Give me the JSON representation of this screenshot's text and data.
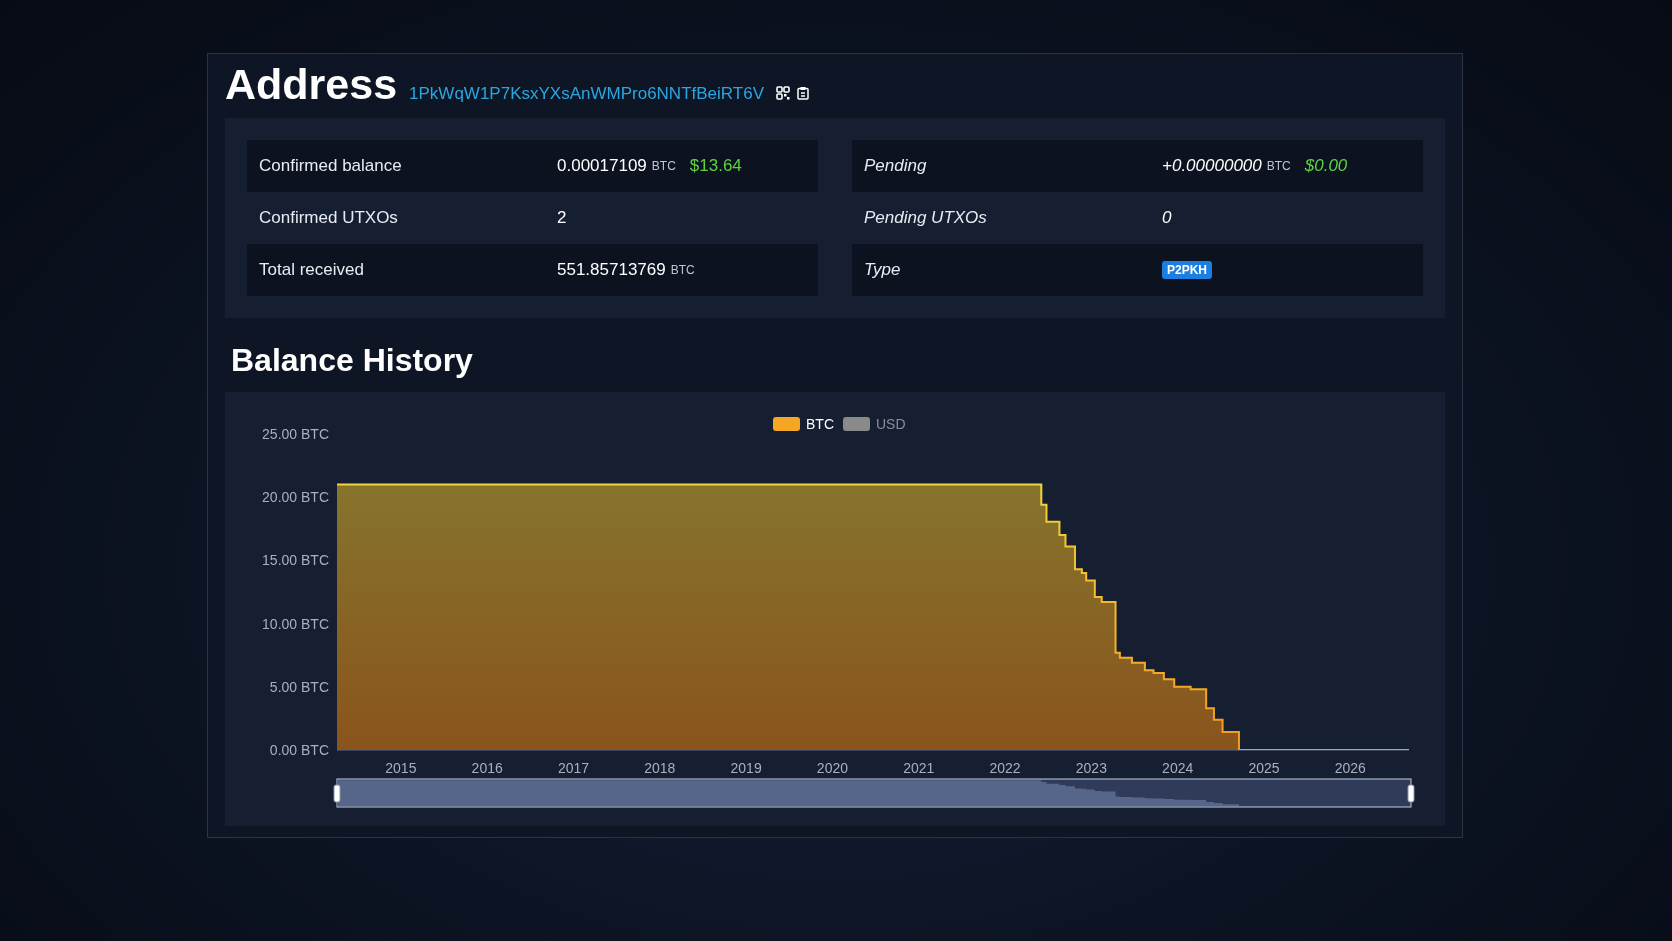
{
  "header": {
    "title": "Address",
    "address": "1PkWqW1P7KsxYXsAnWMPro6NNTfBeiRT6V"
  },
  "summary": {
    "columns": [
      {
        "kind": "confirmed",
        "rows": [
          {
            "label": "Confirmed balance",
            "value": "0.00017109",
            "unit": "BTC",
            "fiat": "$13.64"
          },
          {
            "label": "Confirmed UTXOs",
            "value": "2"
          },
          {
            "label": "Total received",
            "value": "551.85713769",
            "unit": "BTC"
          }
        ]
      },
      {
        "kind": "pending",
        "rows": [
          {
            "label": "Pending",
            "value": "+0.00000000",
            "unit": "BTC",
            "fiat": "$0.00"
          },
          {
            "label": "Pending UTXOs",
            "value": "0"
          },
          {
            "label": "Type",
            "badge": "P2PKH"
          }
        ]
      }
    ]
  },
  "balance_history": {
    "title": "Balance History",
    "legend": [
      {
        "label": "USD",
        "on": false,
        "color": "#8a8a8a"
      }
    ],
    "chart_data": {
      "type": "area",
      "xlim": [
        2014.26,
        2026.68
      ],
      "ylim": [
        0,
        25
      ],
      "x": [
        2014.26,
        2022.42,
        2022.48,
        2022.63,
        2022.7,
        2022.81,
        2022.89,
        2022.94,
        2023.04,
        2023.12,
        2023.28,
        2023.33,
        2023.47,
        2023.62,
        2023.72,
        2023.84,
        2023.96,
        2024.15,
        2024.33,
        2024.42,
        2024.52,
        2024.71,
        2026.41,
        2026.68
      ],
      "series": [
        {
          "name": "BTC",
          "color": "#f5a623",
          "values": [
            21.0,
            19.4,
            18.05,
            17.0,
            16.1,
            14.3,
            14.0,
            13.4,
            12.1,
            11.7,
            7.7,
            7.3,
            6.9,
            6.3,
            6.1,
            5.6,
            5.0,
            4.8,
            3.3,
            2.4,
            1.43,
            0,
            0,
            0
          ]
        }
      ],
      "xticks": [
        {
          "value": 2015,
          "label": "2015"
        },
        {
          "value": 2016,
          "label": "2016"
        },
        {
          "value": 2017,
          "label": "2017"
        },
        {
          "value": 2018,
          "label": "2018"
        },
        {
          "value": 2019,
          "label": "2019"
        },
        {
          "value": 2020,
          "label": "2020"
        },
        {
          "value": 2021,
          "label": "2021"
        },
        {
          "value": 2022,
          "label": "2022"
        },
        {
          "value": 2023,
          "label": "2023"
        },
        {
          "value": 2024,
          "label": "2024"
        },
        {
          "value": 2025,
          "label": "2025"
        },
        {
          "value": 2026,
          "label": "2026"
        }
      ],
      "yticks": [
        {
          "value": 0,
          "label": "0.00 BTC"
        },
        {
          "value": 5,
          "label": "5.00 BTC"
        },
        {
          "value": 10,
          "label": "10.00 BTC"
        },
        {
          "value": 15,
          "label": "15.00 BTC"
        },
        {
          "value": 20,
          "label": "20.00 BTC"
        },
        {
          "value": 25,
          "label": "25.00 BTC"
        }
      ]
    }
  }
}
